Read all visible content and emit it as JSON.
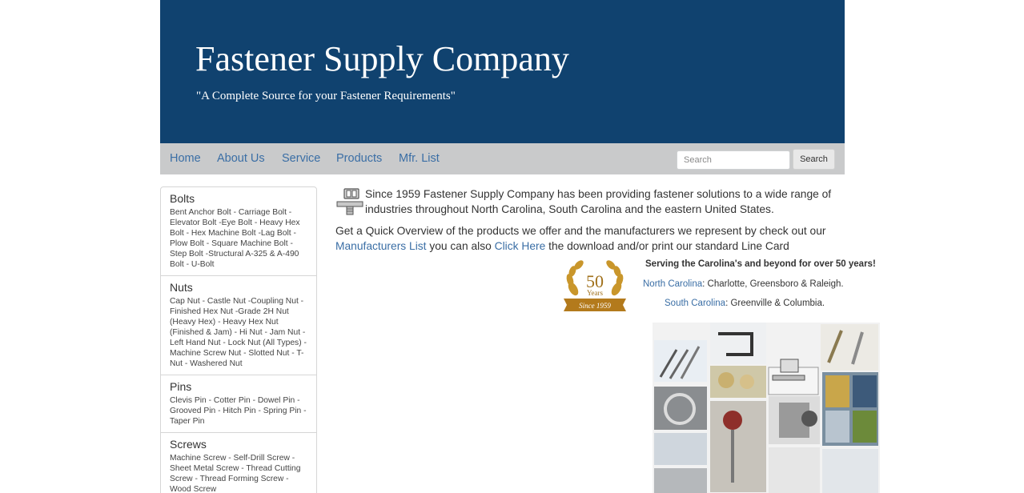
{
  "header": {
    "title": "Fastener Supply Company",
    "tagline": "\"A Complete Source for your Fastener Requirements\""
  },
  "nav": {
    "items": [
      "Home",
      "About Us",
      "Service",
      "Products",
      "Mfr. List"
    ],
    "search_placeholder": "Search",
    "search_button": "Search"
  },
  "sidebar": {
    "categories": [
      {
        "title": "Bolts",
        "items": "Bent Anchor Bolt - Carriage Bolt - Elevator Bolt -Eye Bolt - Heavy Hex Bolt - Hex Machine Bolt -Lag Bolt - Plow Bolt - Square Machine Bolt - Step Bolt -Structural A-325 & A-490 Bolt - U-Bolt"
      },
      {
        "title": "Nuts",
        "items": "Cap Nut - Castle Nut -Coupling Nut - Finished Hex Nut -Grade 2H Nut (Heavy Hex) - Heavy Hex Nut (Finished & Jam) - Hi Nut - Jam Nut - Left Hand Nut - Lock Nut (All Types) - Machine Screw Nut - Slotted Nut - T-Nut - Washered Nut"
      },
      {
        "title": "Pins",
        "items": "Clevis Pin - Cotter Pin - Dowel Pin - Grooved Pin - Hitch Pin - Spring Pin - Taper Pin"
      },
      {
        "title": "Screws",
        "items": "Machine Screw - Self-Drill Screw - Sheet Metal Screw - Thread Cutting Screw - Thread Forming Screw - Wood Screw"
      }
    ]
  },
  "main": {
    "intro": "Since 1959 Fastener Supply Company has been providing fastener solutions to a wide range of industries throughout North Carolina, South Carolina and the eastern United States.",
    "overview_pre": "Get a Quick Overview of the products we offer and the manufacturers we represent by check out our ",
    "overview_link1": "Manufacturers List",
    "overview_mid": " you can also ",
    "overview_link2": "Click Here",
    "overview_post": " the download and/or print our standard Line Card",
    "serving": "Serving the Carolina's and beyond for over 50 years!",
    "nc_label": "North Carolina",
    "nc_cities": ": Charlotte, Greensboro & Raleigh.",
    "sc_label": "South Carolina",
    "sc_cities": ": Greenville & Columbia.",
    "badge_number": "50",
    "badge_years": "Years",
    "badge_since": "Since 1959"
  },
  "colors": {
    "header_bg": "#10426f",
    "nav_bg": "#c9cacb",
    "link": "#3a6ea5"
  }
}
